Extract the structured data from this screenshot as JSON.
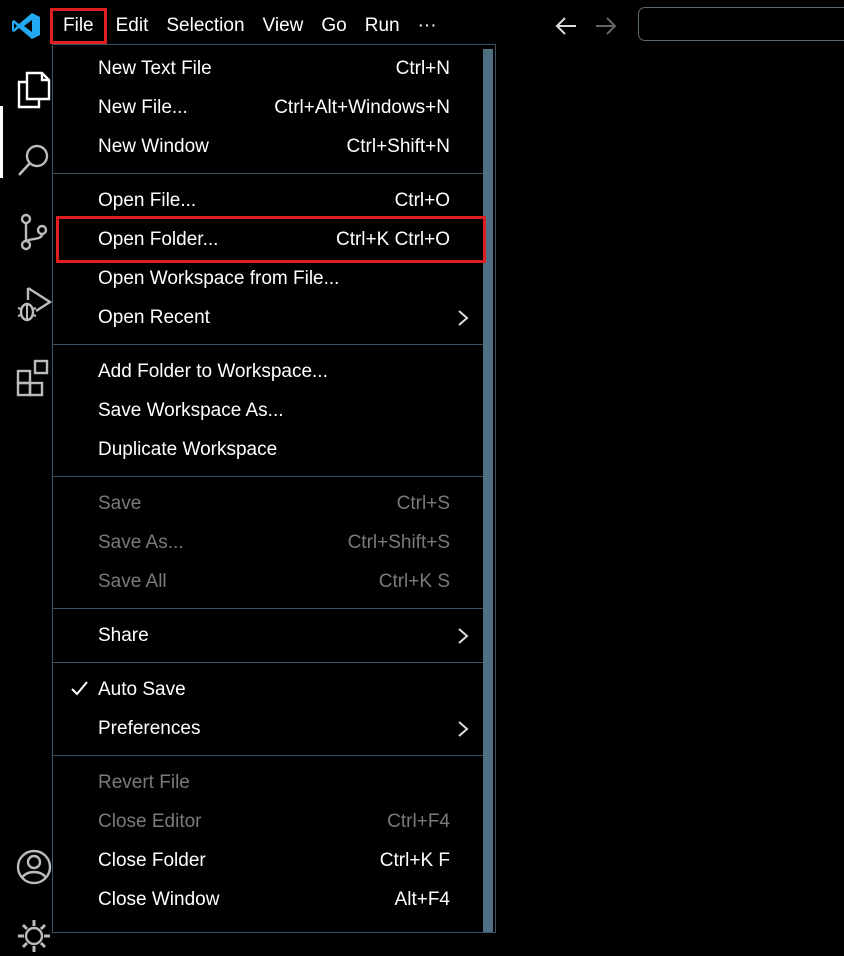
{
  "colors": {
    "accent": "#e02020",
    "logo": "#23a9f2",
    "border": "#3b5564",
    "disabled_text": "#7a7a7a"
  },
  "menubar": {
    "items": [
      "File",
      "Edit",
      "Selection",
      "View",
      "Go",
      "Run",
      "···"
    ],
    "highlighted": "File"
  },
  "activity_icons": [
    "explorer-icon",
    "search-icon",
    "source-control-icon",
    "run-debug-icon",
    "extensions-icon",
    "account-icon",
    "settings-gear-icon"
  ],
  "file_menu": {
    "groups": [
      [
        {
          "label": "New Text File",
          "key": "Ctrl+N"
        },
        {
          "label": "New File...",
          "key": "Ctrl+Alt+Windows+N"
        },
        {
          "label": "New Window",
          "key": "Ctrl+Shift+N"
        }
      ],
      [
        {
          "label": "Open File...",
          "key": "Ctrl+O"
        },
        {
          "label": "Open Folder...",
          "key": "Ctrl+K Ctrl+O",
          "highlighted": true
        },
        {
          "label": "Open Workspace from File...",
          "key": ""
        },
        {
          "label": "Open Recent",
          "key": "",
          "submenu": true
        }
      ],
      [
        {
          "label": "Add Folder to Workspace...",
          "key": ""
        },
        {
          "label": "Save Workspace As...",
          "key": ""
        },
        {
          "label": "Duplicate Workspace",
          "key": ""
        }
      ],
      [
        {
          "label": "Save",
          "key": "Ctrl+S",
          "disabled": true
        },
        {
          "label": "Save As...",
          "key": "Ctrl+Shift+S",
          "disabled": true
        },
        {
          "label": "Save All",
          "key": "Ctrl+K S",
          "disabled": true
        }
      ],
      [
        {
          "label": "Share",
          "key": "",
          "submenu": true
        }
      ],
      [
        {
          "label": "Auto Save",
          "key": "",
          "checked": true
        },
        {
          "label": "Preferences",
          "key": "",
          "submenu": true
        }
      ],
      [
        {
          "label": "Revert File",
          "key": "",
          "disabled": true
        },
        {
          "label": "Close Editor",
          "key": "Ctrl+F4",
          "disabled": true
        },
        {
          "label": "Close Folder",
          "key": "Ctrl+K F"
        },
        {
          "label": "Close Window",
          "key": "Alt+F4"
        }
      ]
    ]
  }
}
